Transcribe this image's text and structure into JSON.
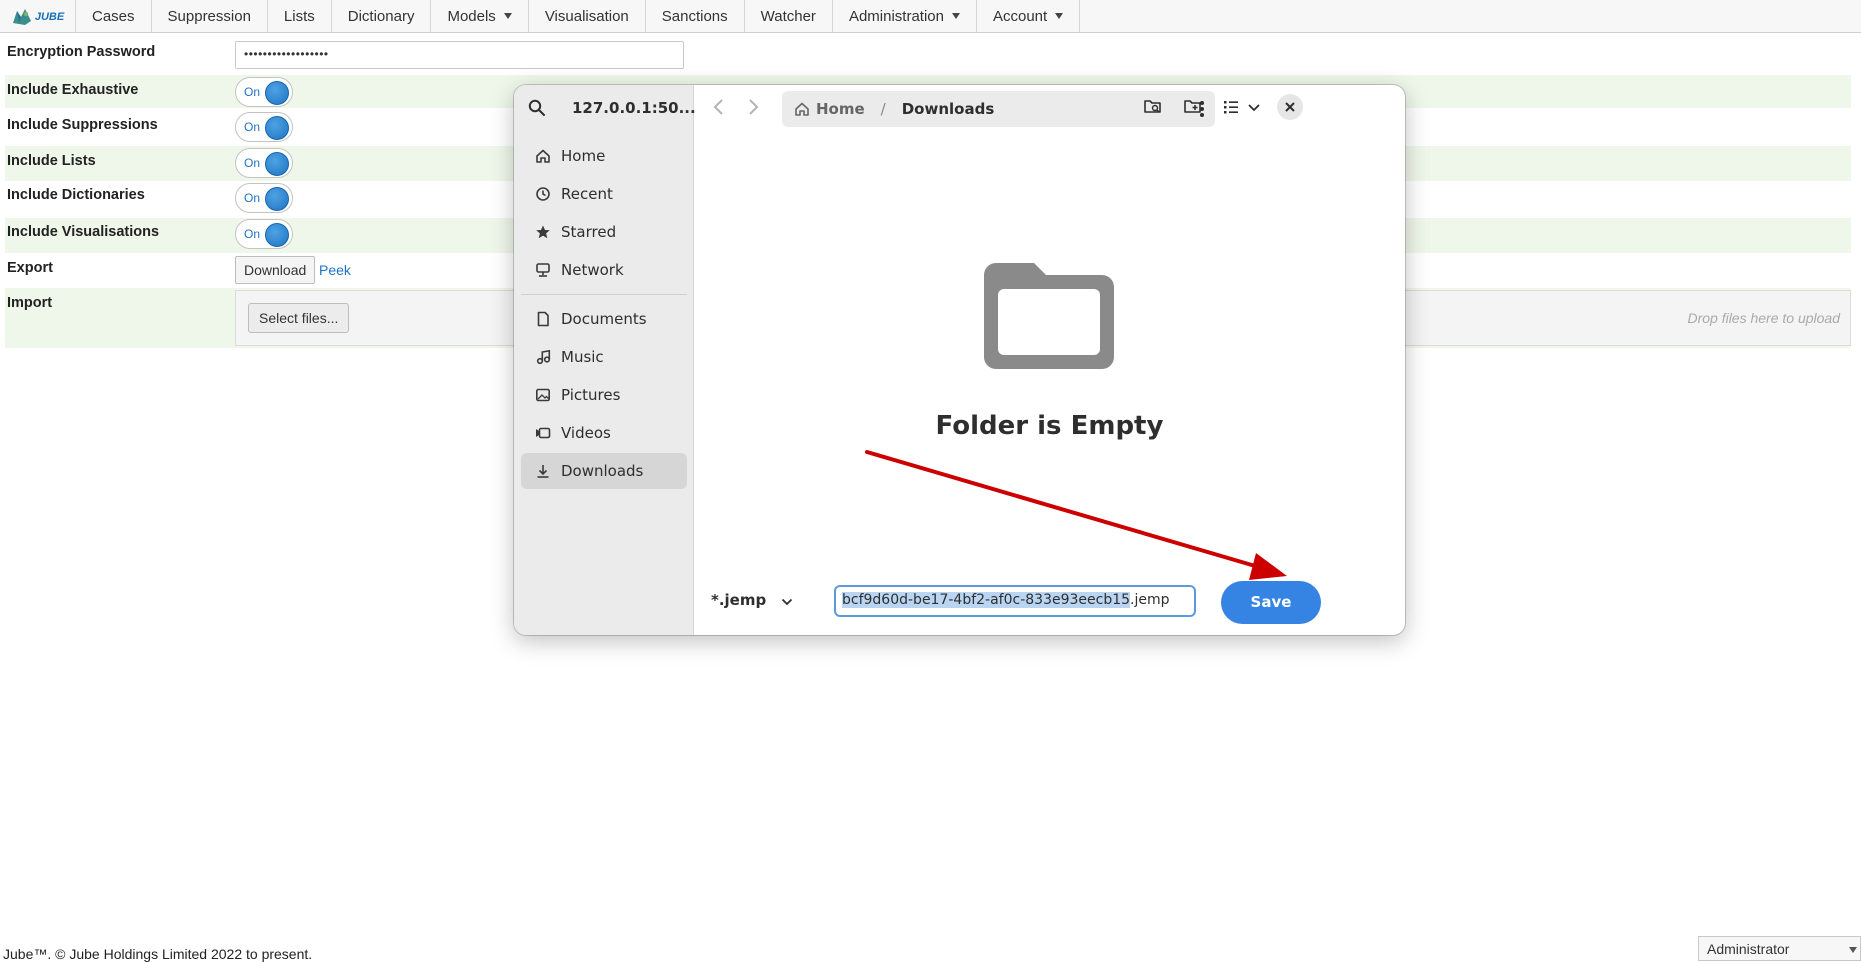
{
  "nav": {
    "logo_text": "JUBE",
    "items": [
      {
        "label": "Cases",
        "dropdown": false
      },
      {
        "label": "Suppression",
        "dropdown": false
      },
      {
        "label": "Lists",
        "dropdown": false
      },
      {
        "label": "Dictionary",
        "dropdown": false
      },
      {
        "label": "Models",
        "dropdown": true
      },
      {
        "label": "Visualisation",
        "dropdown": false
      },
      {
        "label": "Sanctions",
        "dropdown": false
      },
      {
        "label": "Watcher",
        "dropdown": false
      },
      {
        "label": "Administration",
        "dropdown": true
      },
      {
        "label": "Account",
        "dropdown": true
      }
    ]
  },
  "form": {
    "encryption_password": {
      "label": "Encryption Password",
      "value": "••••••••••••••••••"
    },
    "include_exhaustive": {
      "label": "Include Exhaustive",
      "state": "On"
    },
    "include_suppressions": {
      "label": "Include Suppressions",
      "state": "On"
    },
    "include_lists": {
      "label": "Include Lists",
      "state": "On"
    },
    "include_dictionaries": {
      "label": "Include Dictionaries",
      "state": "On"
    },
    "include_visualisations": {
      "label": "Include Visualisations",
      "state": "On"
    },
    "export": {
      "label": "Export",
      "download_label": "Download",
      "peek_label": "Peek"
    },
    "import": {
      "label": "Import",
      "select_label": "Select files...",
      "drop_hint": "Drop files here to upload"
    }
  },
  "footer": {
    "copyright": "Jube™. © Jube Holdings Limited 2022 to present.",
    "role": "Administrator"
  },
  "dialog": {
    "location_title": "127.0.0.1:50...",
    "sidebar": [
      {
        "label": "Home",
        "icon": "home-icon"
      },
      {
        "label": "Recent",
        "icon": "clock-icon"
      },
      {
        "label": "Starred",
        "icon": "star-icon"
      },
      {
        "label": "Network",
        "icon": "network-icon"
      },
      {
        "label": "Documents",
        "icon": "document-icon"
      },
      {
        "label": "Music",
        "icon": "music-icon"
      },
      {
        "label": "Pictures",
        "icon": "picture-icon"
      },
      {
        "label": "Videos",
        "icon": "video-icon"
      },
      {
        "label": "Downloads",
        "icon": "download-icon",
        "active": true
      }
    ],
    "breadcrumb": {
      "home": "Home",
      "separator": "/",
      "current": "Downloads"
    },
    "empty_message": "Folder is Empty",
    "filter": "*.jemp",
    "filename_selected": "bcf9d60d-be17-4bf2-af0c-833e93eecb15",
    "filename_ext": ".jemp",
    "save_label": "Save"
  },
  "colors": {
    "accent": "#3584e4",
    "toggle_on": "#1f74c2",
    "row_alt": "#eff7ea",
    "annotation_arrow": "#cc0000"
  }
}
